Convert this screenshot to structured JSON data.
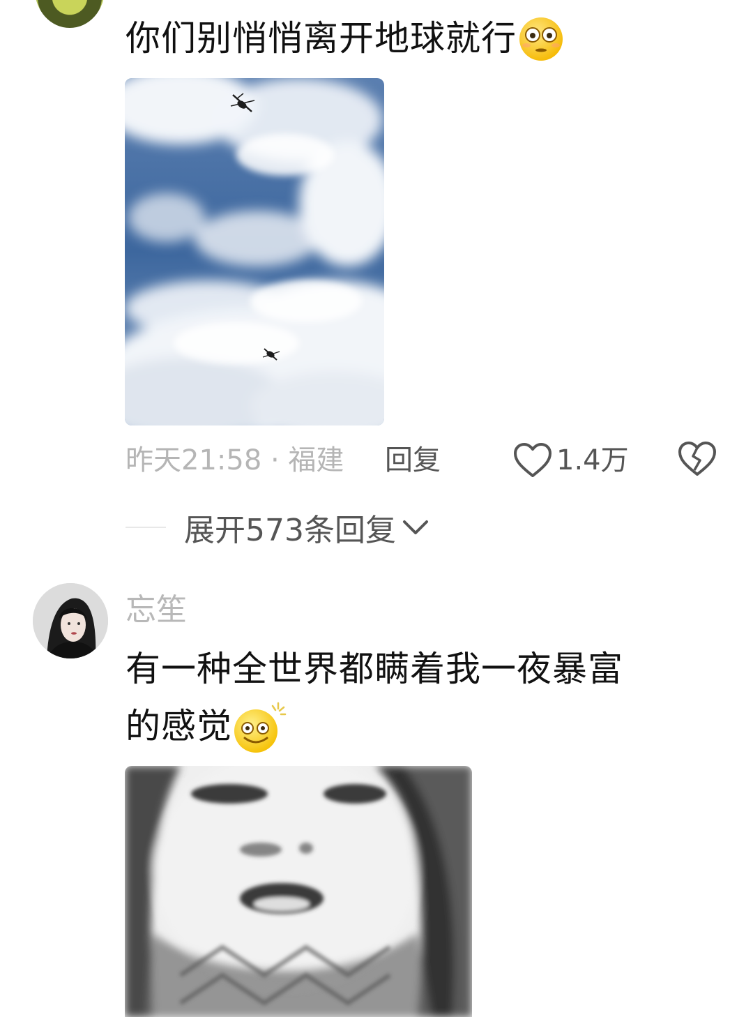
{
  "comment1": {
    "text": "你们别悄悄离开地球就行",
    "emoji": "flushed-face-emoji",
    "time_location": "昨天21:58 · 福建",
    "reply_label": "回复",
    "like_count": "1.4万",
    "expand_label": "展开573条回复"
  },
  "comment2": {
    "username": "忘笙",
    "text_line1": "有一种全世界都瞒着我一夜暴富",
    "text_line2": "的感觉",
    "emoji": "dizzy-smile-emoji"
  },
  "icons": {
    "like": "heart-outline-icon",
    "dislike": "broken-heart-icon",
    "expand": "chevron-down-icon"
  },
  "colors": {
    "text_primary": "#111111",
    "text_meta": "#b5b5b5",
    "text_action": "#555555"
  }
}
